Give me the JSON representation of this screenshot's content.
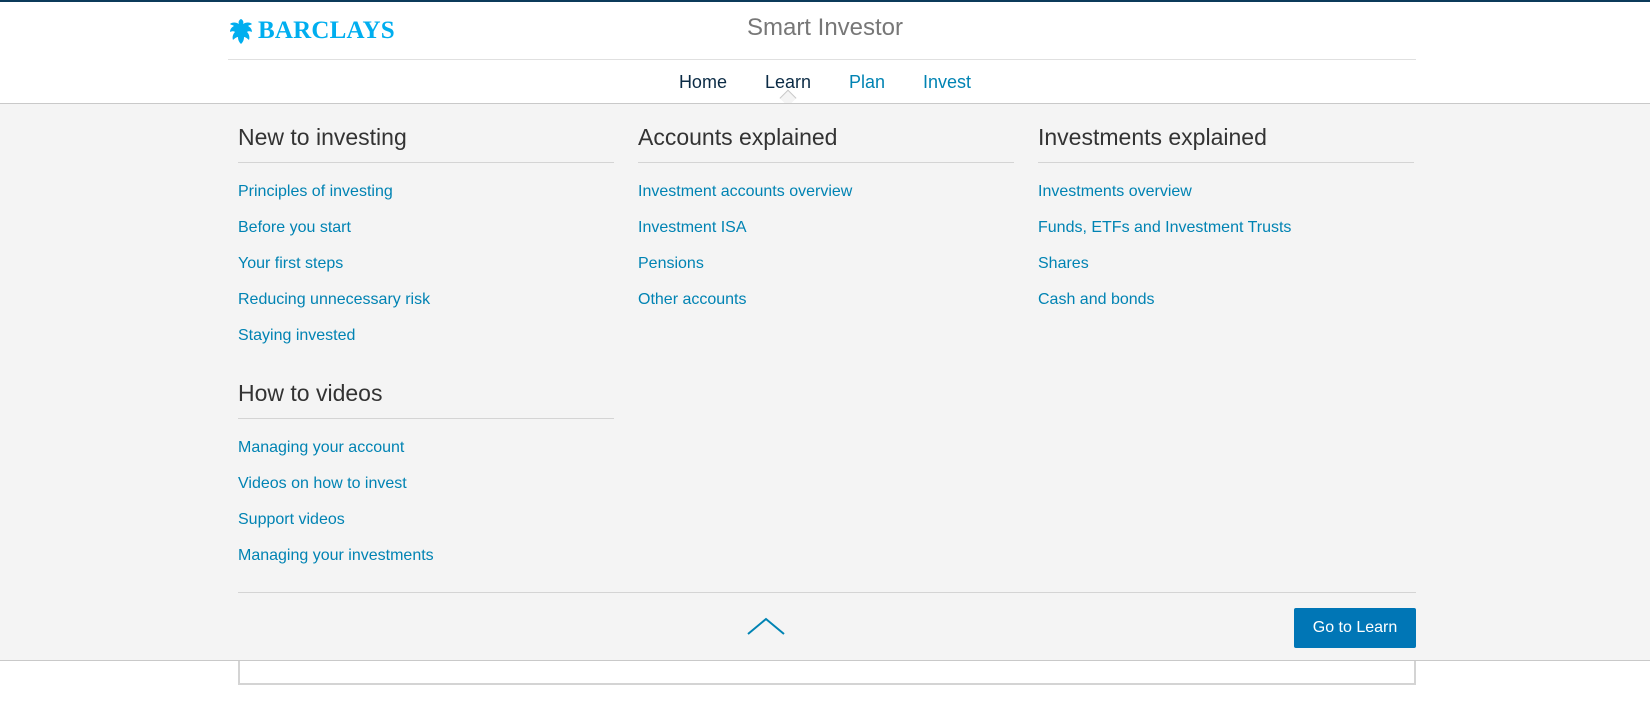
{
  "brand": {
    "logo_text": "BARCLAYS",
    "logo_icon": "eagle-icon",
    "accent_color": "#00aeef"
  },
  "header": {
    "app_title": "Smart Investor"
  },
  "nav": {
    "items": [
      {
        "label": "Home"
      },
      {
        "label": "Learn",
        "active": true
      },
      {
        "label": "Plan"
      },
      {
        "label": "Invest"
      }
    ]
  },
  "menu": {
    "columns": [
      {
        "sections": [
          {
            "heading": "New to investing",
            "links": [
              "Principles of investing",
              "Before you start",
              "Your first steps",
              "Reducing unnecessary risk",
              "Staying invested"
            ]
          },
          {
            "heading": "How to videos",
            "links": [
              "Managing your account",
              "Videos on how to invest",
              "Support videos",
              "Managing your investments"
            ]
          }
        ]
      },
      {
        "sections": [
          {
            "heading": "Accounts explained",
            "links": [
              "Investment accounts overview",
              "Investment ISA",
              "Pensions",
              "Other accounts"
            ]
          }
        ]
      },
      {
        "sections": [
          {
            "heading": "Investments explained",
            "links": [
              "Investments overview",
              "Funds, ETFs and Investment Trusts",
              "Shares",
              "Cash and bonds"
            ]
          }
        ]
      }
    ],
    "collapse_icon": "chevron-up-icon",
    "go_button_label": "Go to Learn",
    "go_button_color": "#0076b6"
  }
}
